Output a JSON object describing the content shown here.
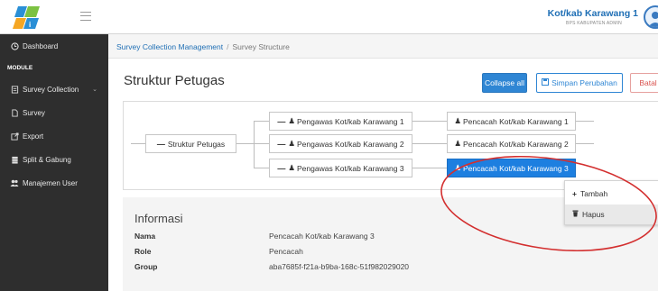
{
  "header": {
    "user_name": "Kot/kab Karawang 1",
    "user_role": "BPS KABUPATEN ADMIN"
  },
  "sidebar": {
    "items": [
      {
        "label": "Dashboard",
        "icon": "clock-icon"
      },
      {
        "label": "MODULE",
        "section": true
      },
      {
        "label": "Survey Collection",
        "icon": "survey-collection-icon",
        "has_caret": true
      },
      {
        "label": "Survey",
        "icon": "document-icon"
      },
      {
        "label": "Export",
        "icon": "export-icon"
      },
      {
        "label": "Split & Gabung",
        "icon": "database-icon"
      },
      {
        "label": "Manajemen User",
        "icon": "users-icon"
      }
    ]
  },
  "breadcrumb": {
    "parent": "Survey Collection Management",
    "separator": "/",
    "current": "Survey Structure"
  },
  "page": {
    "title": "Struktur Petugas",
    "collapse_label": "Collapse all",
    "save_label": "Simpan Perubahan",
    "cancel_label": "Batal"
  },
  "tree": {
    "root": "Struktur Petugas",
    "pengawas": [
      "Pengawas Kot/kab Karawang 1",
      "Pengawas Kot/kab Karawang 2",
      "Pengawas Kot/kab Karawang 3"
    ],
    "pencacah": [
      "Pencacah Kot/kab Karawang 1",
      "Pencacah Kot/kab Karawang 2",
      "Pencacah Kot/kab Karawang 3"
    ],
    "selected_index": 2
  },
  "info": {
    "title": "Informasi",
    "rows": [
      {
        "label": "Nama",
        "value": "Pencacah Kot/kab Karawang 3"
      },
      {
        "label": "Role",
        "value": "Pencacah"
      },
      {
        "label": "Group",
        "value": "aba7685f-f21a-b9ba-168c-51f982029020"
      }
    ]
  },
  "context_menu": {
    "items": [
      {
        "label": "Tambah",
        "icon": "plus-icon"
      },
      {
        "label": "Hapus",
        "icon": "trash-icon"
      }
    ]
  },
  "colors": {
    "sidebar_bg": "#2e2e2e",
    "primary": "#2f86d4",
    "selected_node": "#1d7fe0",
    "danger": "#d9534f",
    "annotation": "#d32f2f"
  }
}
